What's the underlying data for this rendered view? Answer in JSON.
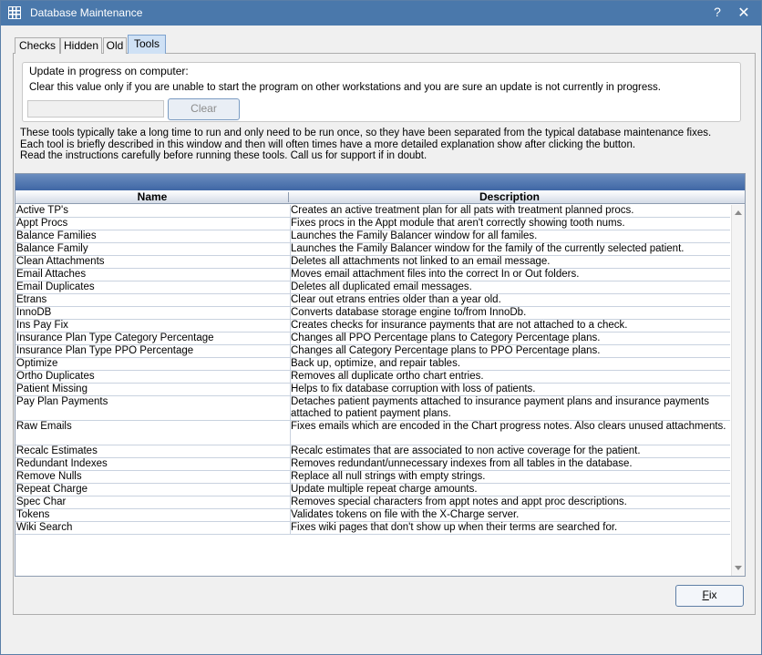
{
  "window": {
    "title": "Database Maintenance",
    "help_label": "?",
    "close_label": "✕"
  },
  "tabs": [
    {
      "label": "Checks",
      "active": false
    },
    {
      "label": "Hidden",
      "active": false
    },
    {
      "label": "Old",
      "active": false
    },
    {
      "label": "Tools",
      "active": true
    }
  ],
  "update_group": {
    "title": "Update in progress on computer:",
    "description": "Clear this value only if you are unable to start the program on other workstations and you are sure an update is not currently in progress.",
    "computer_value": "",
    "clear_label": "Clear"
  },
  "info_lines": [
    "These tools typically take a long time to run and only need to be run once, so they have been separated from the typical database maintenance fixes.",
    "Each tool is briefly described in this window and then will often times have a more detailed explanation show after clicking the button.",
    "Read the instructions carefully before running these tools.  Call us for support if in doubt."
  ],
  "grid": {
    "columns": [
      "Name",
      "Description"
    ],
    "rows": [
      {
        "name": "Active TP's",
        "description": "Creates an active treatment plan for all pats with treatment planned procs."
      },
      {
        "name": "Appt Procs",
        "description": "Fixes procs in the Appt module that aren't correctly showing tooth nums."
      },
      {
        "name": "Balance Families",
        "description": "Launches the Family Balancer window for all familes."
      },
      {
        "name": "Balance Family",
        "description": "Launches the Family Balancer window for the family of the currently selected patient."
      },
      {
        "name": "Clean Attachments",
        "description": "Deletes all attachments not linked to an email message."
      },
      {
        "name": "Email Attaches",
        "description": "Moves email attachment files into the correct In or Out folders."
      },
      {
        "name": "Email Duplicates",
        "description": "Deletes all duplicated email messages."
      },
      {
        "name": "Etrans",
        "description": "Clear out etrans entries older than a year old."
      },
      {
        "name": "InnoDB",
        "description": "Converts database storage engine to/from InnoDb."
      },
      {
        "name": "Ins Pay Fix",
        "description": "Creates checks for insurance payments that are not attached to a check."
      },
      {
        "name": "Insurance Plan Type Category Percentage",
        "description": "Changes all PPO Percentage plans to Category Percentage plans."
      },
      {
        "name": "Insurance Plan Type PPO Percentage",
        "description": "Changes all Category Percentage plans to PPO Percentage plans."
      },
      {
        "name": "Optimize",
        "description": "Back up, optimize, and repair tables."
      },
      {
        "name": "Ortho Duplicates",
        "description": "Removes all duplicate ortho chart entries."
      },
      {
        "name": "Patient Missing",
        "description": "Helps to fix database corruption with loss of patients."
      },
      {
        "name": "Pay Plan Payments",
        "description": "Detaches patient payments attached to insurance payment plans and insurance payments attached to patient payment plans."
      },
      {
        "name": "Raw Emails",
        "description": "Fixes emails which are encoded in the Chart progress notes.  Also clears unused attachments."
      },
      {
        "name": "Recalc Estimates",
        "description": "Recalc estimates that are associated to non active coverage for the patient."
      },
      {
        "name": "Redundant Indexes",
        "description": "Removes redundant/unnecessary indexes from all tables in the database."
      },
      {
        "name": "Remove Nulls",
        "description": "Replace all null strings with empty strings."
      },
      {
        "name": "Repeat Charge",
        "description": "Update multiple repeat charge amounts."
      },
      {
        "name": "Spec Char",
        "description": "Removes special characters from appt notes and appt proc descriptions."
      },
      {
        "name": "Tokens",
        "description": "Validates tokens on file with the X-Charge server."
      },
      {
        "name": "Wiki Search",
        "description": "Fixes wiki pages that don't show up when their terms are searched for."
      }
    ]
  },
  "fix_button": {
    "mnemonic": "F",
    "rest": "ix"
  }
}
